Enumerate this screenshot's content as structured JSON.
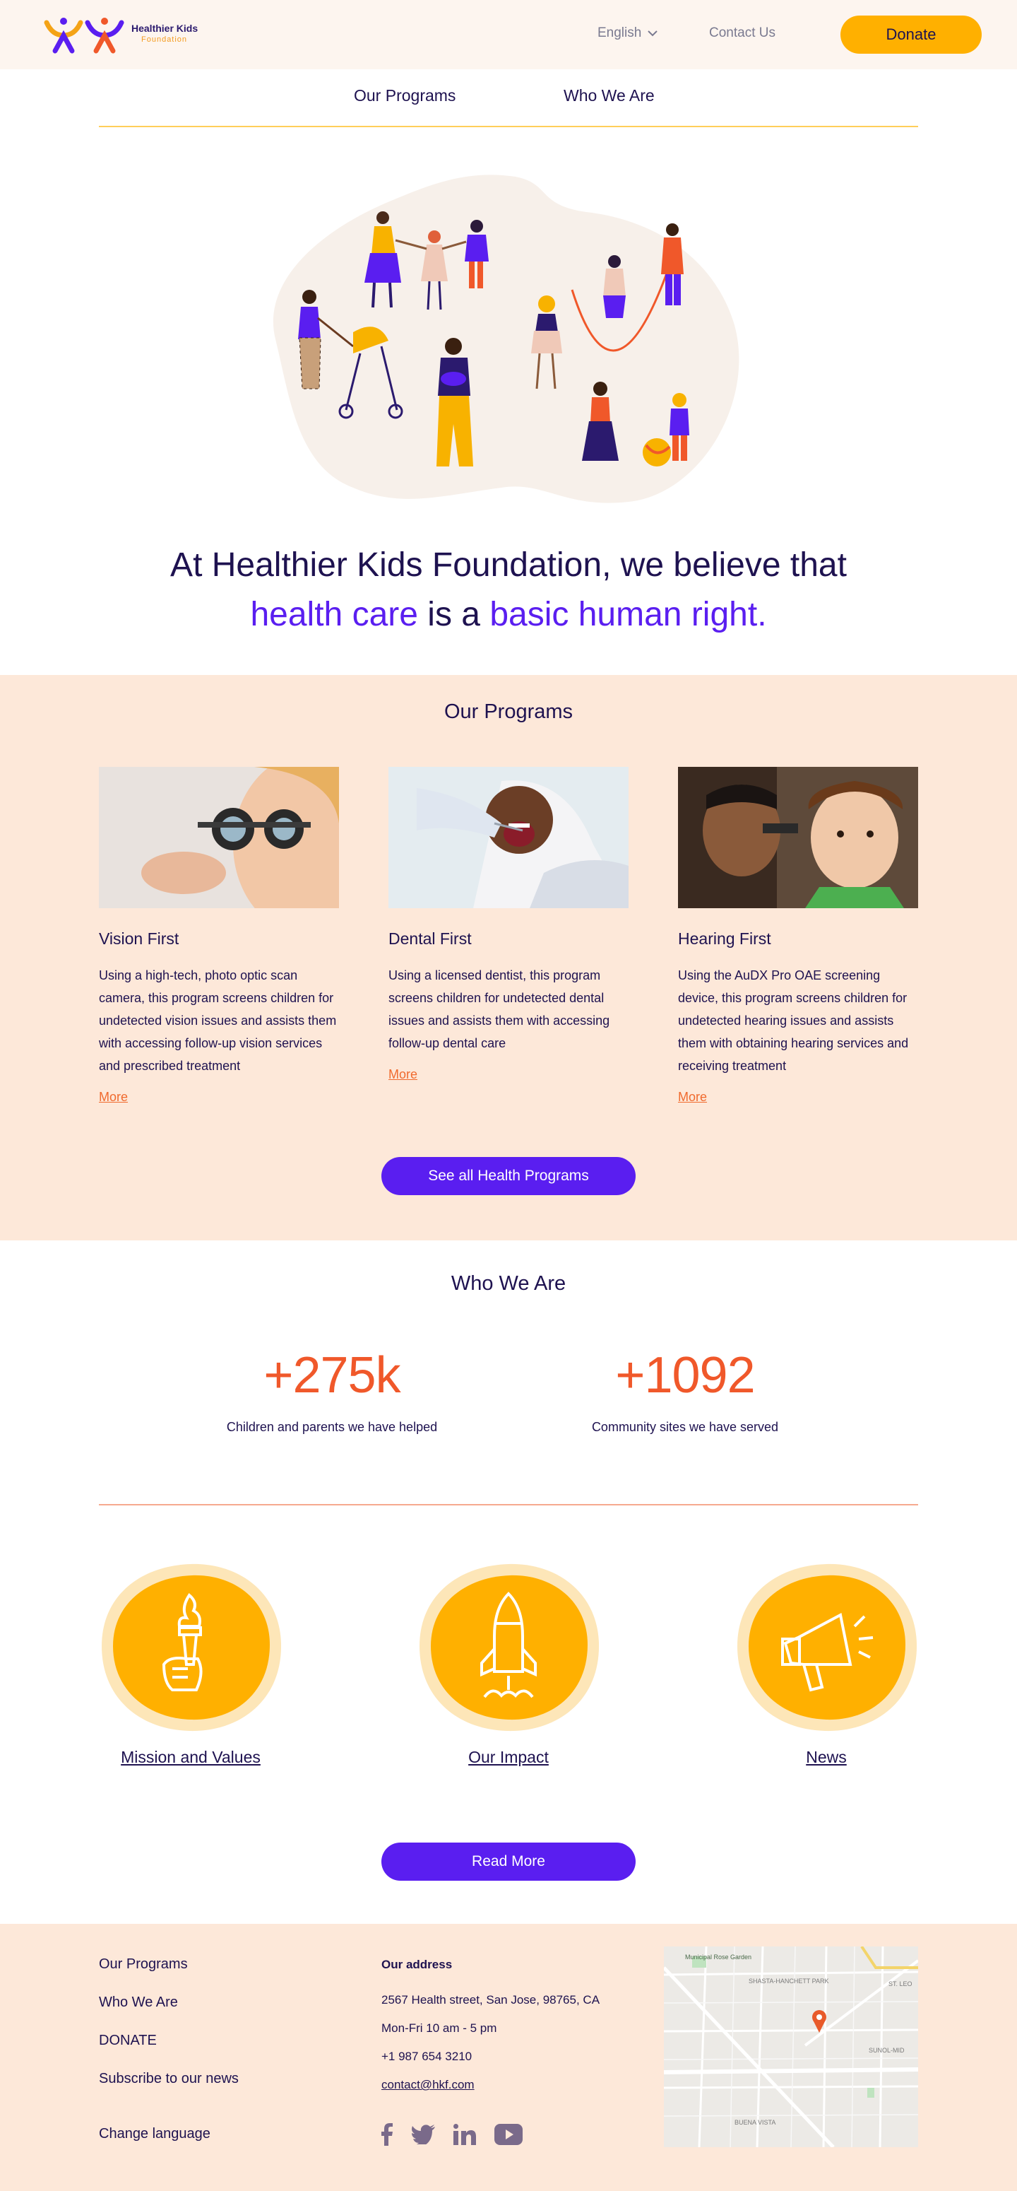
{
  "header": {
    "logo_name": "Healthier Kids",
    "logo_sub": "Foundation",
    "language": "English",
    "contact": "Contact Us",
    "donate": "Donate"
  },
  "nav": {
    "programs": "Our Programs",
    "who": "Who We Are"
  },
  "hero": {
    "line1": "At Healthier Kids Foundation, we believe that",
    "accent1": "health care",
    "mid": " is a ",
    "accent2": "basic human right."
  },
  "programs": {
    "title": "Our Programs",
    "cards": [
      {
        "title": "Vision First",
        "text": "Using a high-tech, photo optic scan camera, this program screens children for undetected vision issues and assists them with accessing follow-up vision services and prescribed treatment",
        "more": "More"
      },
      {
        "title": "Dental First",
        "text": "Using a licensed dentist, this program screens children for undetected dental issues and assists  them with accessing follow-up dental care",
        "more": "More"
      },
      {
        "title": "Hearing First",
        "text": "Using the AuDX Pro OAE screening device, this program screens children for undetected hearing issues and assists them with obtaining hearing services and receiving treatment",
        "more": "More"
      }
    ],
    "cta": "See all Health Programs"
  },
  "who": {
    "title": "Who We Are",
    "stats": [
      {
        "value": "+275k",
        "label": "Children and parents we have helped"
      },
      {
        "value": "+1092",
        "label": "Community sites we have served"
      }
    ],
    "features": [
      {
        "label": "Mission and Values",
        "icon": "torch-icon"
      },
      {
        "label": "Our Impact",
        "icon": "rocket-icon"
      },
      {
        "label": "News",
        "icon": "megaphone-icon"
      }
    ],
    "cta": "Read More"
  },
  "footer": {
    "links": [
      "Our Programs",
      "Who We Are",
      "DONATE",
      "Subscribe to our news",
      "Change language"
    ],
    "address_title": "Our address",
    "address": "2567 Health street, San Jose, 98765, CA",
    "hours": "Mon-Fri  10 am - 5 pm",
    "phone": "+1 987 654 3210",
    "email": "contact@hkf.com",
    "socials": [
      "facebook-icon",
      "twitter-icon",
      "linkedin-icon",
      "youtube-icon"
    ],
    "map_labels": {
      "garden": "Municipal Rose Garden",
      "park": "SHASTA-HANCHETT PARK",
      "st": "ST. LEO",
      "sunol": "SUNOL-MID",
      "buena": "BUENA VISTA"
    }
  },
  "colors": {
    "navy": "#1e1250",
    "purple": "#5a1ef0",
    "orange": "#f0582a",
    "yellow": "#ffb000",
    "peach": "#fde8d9",
    "cream": "#fdf5ef"
  }
}
